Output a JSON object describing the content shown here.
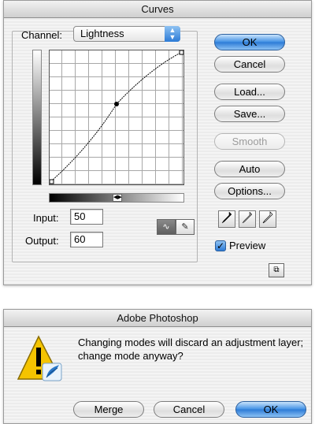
{
  "curves_dialog": {
    "title": "Curves",
    "channel_label": "Channel:",
    "channel_value": "Lightness",
    "input_label": "Input:",
    "input_value": "50",
    "output_label": "Output:",
    "output_value": "60",
    "buttons": {
      "ok": "OK",
      "cancel": "Cancel",
      "load": "Load...",
      "save": "Save...",
      "smooth": "Smooth",
      "auto": "Auto",
      "options": "Options..."
    },
    "preview_label": "Preview",
    "preview_checked": true,
    "curve_point": {
      "input": 50,
      "output": 60
    },
    "icons": [
      "curve-tool-icon",
      "pencil-tool-icon",
      "black-eyedropper-icon",
      "gray-eyedropper-icon",
      "white-eyedropper-icon",
      "expand-icon"
    ]
  },
  "alert_dialog": {
    "title": "Adobe Photoshop",
    "message": "Changing modes will discard an adjustment layer; change mode anyway?",
    "buttons": {
      "merge": "Merge",
      "cancel": "Cancel",
      "ok": "OK"
    },
    "icon": "warning-icon"
  },
  "colors": {
    "default_button": "#2c7ad6",
    "warning_yellow": "#f5c400"
  }
}
